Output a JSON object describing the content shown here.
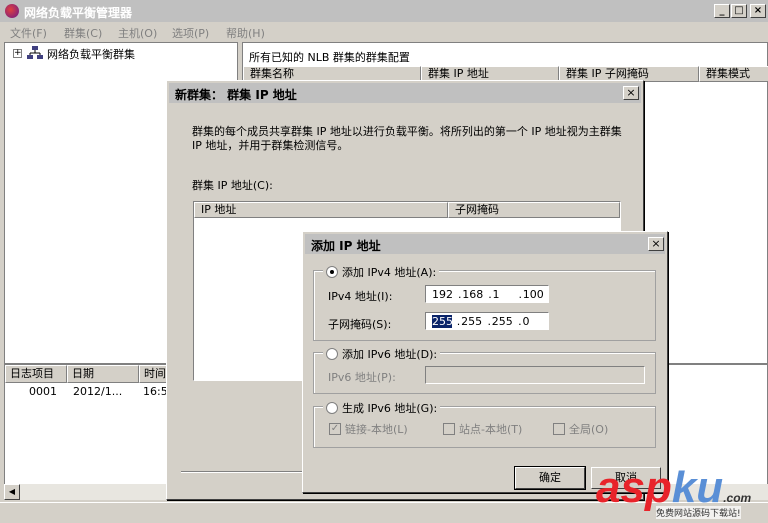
{
  "app": {
    "title": "网络负载平衡管理器",
    "window_buttons": [
      "_",
      "□",
      "×"
    ]
  },
  "menu": [
    "文件(F)",
    "群集(C)",
    "主机(O)",
    "选项(P)",
    "帮助(H)"
  ],
  "tree": {
    "root_label": "网络负载平衡群集",
    "expander": "+"
  },
  "cluster_list": {
    "caption": "所有已知的 NLB 群集的群集配置",
    "columns": [
      "群集名称",
      "群集 IP 地址",
      "群集 IP 子网掩码",
      "群集模式"
    ]
  },
  "log": {
    "columns": [
      "日志项目",
      "日期",
      "时间"
    ],
    "rows": [
      {
        "item": "0001",
        "date": "2012/1...",
        "time": "16:5"
      }
    ]
  },
  "dialog_cluster_ip": {
    "title": "新群集：  群集 IP 地址",
    "close": "×",
    "description": "群集的每个成员共享群集 IP 地址以进行负载平衡。将所列出的第一个 IP 地址视为主群集 IP 地址，并用于群集检测信号。",
    "list_label": "群集 IP 地址(C):",
    "columns": [
      "IP 地址",
      "子网掩码"
    ]
  },
  "dialog_add_ip": {
    "title": "添加 IP 地址",
    "close": "×",
    "ipv4_radio": "添加 IPv4 地址(A):",
    "ipv4_address_label": "IPv4 地址(I):",
    "ipv4_address": [
      "192",
      "168",
      "1",
      "100"
    ],
    "subnet_label": "子网掩码(S):",
    "subnet_mask": [
      "255",
      "255",
      "255",
      "0"
    ],
    "ipv6_radio": "添加 IPv6 地址(D):",
    "ipv6_address_label": "IPv6 地址(P):",
    "generate_radio": "生成 IPv6 地址(G):",
    "link_local": "链接-本地(L)",
    "site_local": "站点-本地(T)",
    "global": "全局(O)",
    "ok": "确定",
    "cancel": "取消"
  },
  "watermark": {
    "asp": "asp",
    "ku": "ku",
    "suffix": ".com",
    "sub": "免费网站源码下载站!"
  }
}
